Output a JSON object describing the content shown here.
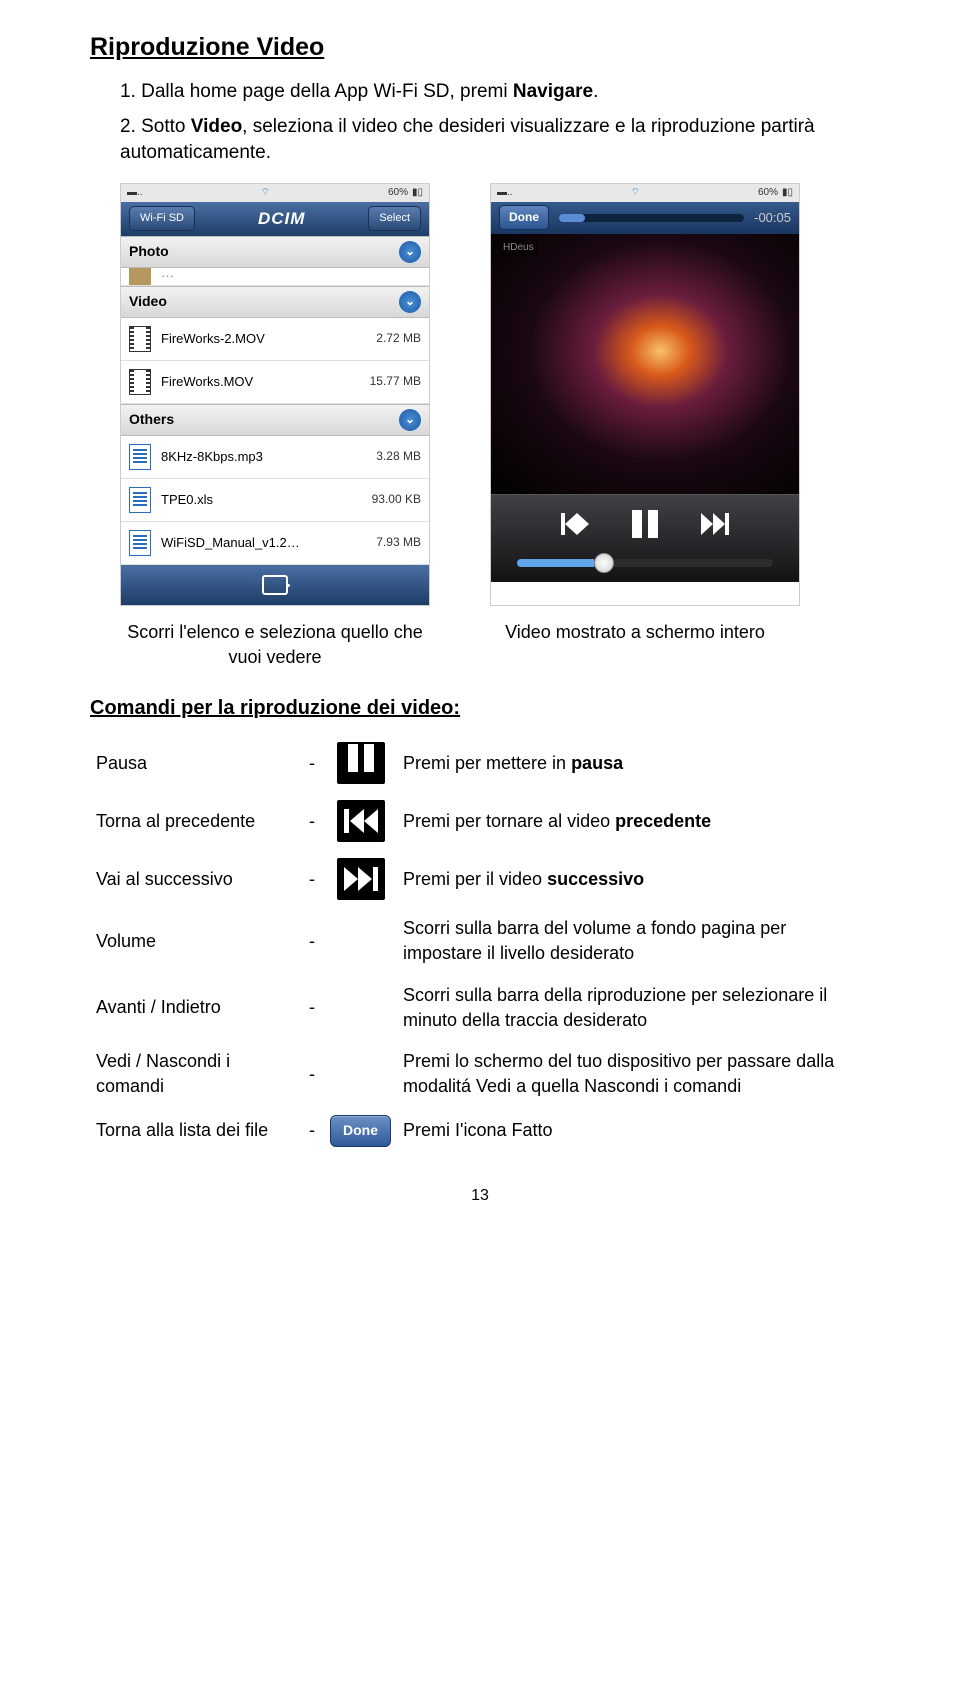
{
  "title": "Riproduzione Video",
  "steps": [
    {
      "prefix": "1. Dalla home page della App Wi-Fi SD, premi ",
      "bold": "Navigare",
      "suffix": "."
    },
    {
      "prefix": "2. Sotto ",
      "bold": "Video",
      "mid": ", seleziona il video che desideri visualizzare e la riproduzione partirà automaticamente."
    }
  ],
  "phone1": {
    "battery": "60%",
    "nav_left": "Wi-Fi SD",
    "nav_title": "DCIM",
    "nav_right": "Select",
    "sections": {
      "photo": "Photo",
      "video": "Video",
      "others": "Others"
    },
    "video_rows": [
      {
        "name": "FireWorks-2.MOV",
        "size": "2.72 MB"
      },
      {
        "name": "FireWorks.MOV",
        "size": "15.77 MB"
      }
    ],
    "other_rows": [
      {
        "name": "8KHz-8Kbps.mp3",
        "size": "3.28 MB"
      },
      {
        "name": "TPE0.xls",
        "size": "93.00 KB"
      },
      {
        "name": "WiFiSD_Manual_v1.2…",
        "size": "7.93 MB"
      }
    ]
  },
  "phone2": {
    "battery": "60%",
    "done": "Done",
    "time_remaining": "-00:05",
    "hd_label": "HDeus"
  },
  "captions": {
    "left": "Scorri l'elenco e seleziona quello che vuoi vedere",
    "right": "Video mostrato a schermo intero"
  },
  "commands_title": "Comandi per la riproduzione dei video:",
  "commands": {
    "pause": {
      "name": "Pausa",
      "desc_pre": "Premi per mettere in ",
      "desc_bold": "pausa"
    },
    "prev": {
      "name": "Torna al precedente",
      "desc_pre": "Premi per tornare al video ",
      "desc_bold": "precedente"
    },
    "next": {
      "name": "Vai al successivo",
      "desc_pre": "Premi per il video ",
      "desc_bold": "successivo"
    },
    "volume": {
      "name": "Volume",
      "desc": "Scorri sulla barra del volume a fondo pagina per impostare il livello desiderato"
    },
    "seek": {
      "name": "Avanti / Indietro",
      "desc": "Scorri sulla barra della riproduzione per selezionare il minuto della traccia desiderato"
    },
    "showhide": {
      "name": "Vedi / Nascondi i comandi",
      "desc": "Premi lo schermo del tuo dispositivo per passare dalla modalitá Vedi a quella Nascondi i comandi"
    },
    "back": {
      "name": "Torna alla lista dei file",
      "button": "Done",
      "desc": "Premi I'icona Fatto"
    }
  },
  "page_number": "13"
}
